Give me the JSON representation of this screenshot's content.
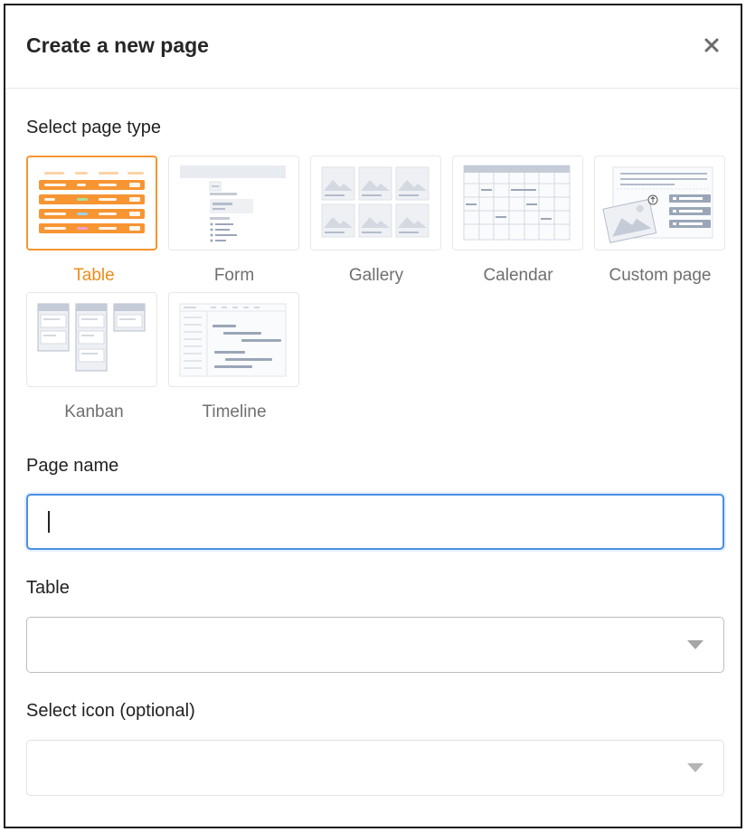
{
  "dialog": {
    "title": "Create a new page",
    "close_icon": "close-icon"
  },
  "page_type": {
    "label": "Select page type",
    "selected": "Table",
    "types": [
      {
        "label": "Table",
        "icon": "table-preview-icon"
      },
      {
        "label": "Form",
        "icon": "form-preview-icon"
      },
      {
        "label": "Gallery",
        "icon": "gallery-preview-icon"
      },
      {
        "label": "Calendar",
        "icon": "calendar-preview-icon"
      },
      {
        "label": "Custom page",
        "icon": "custom-page-preview-icon"
      },
      {
        "label": "Kanban",
        "icon": "kanban-preview-icon"
      },
      {
        "label": "Timeline",
        "icon": "timeline-preview-icon"
      }
    ]
  },
  "page_name": {
    "label": "Page name",
    "value": ""
  },
  "table_select": {
    "label": "Table",
    "value": ""
  },
  "icon_select": {
    "label": "Select icon (optional)",
    "value": ""
  },
  "colors": {
    "accent": "#f79533",
    "focus": "#4a90e2"
  }
}
